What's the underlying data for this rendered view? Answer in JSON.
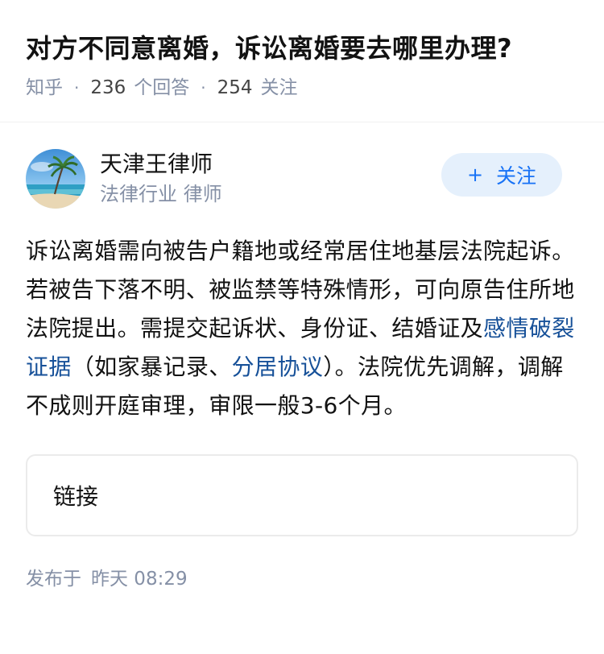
{
  "question": {
    "title": "对方不同意离婚，诉讼离婚要去哪里办理?",
    "source": "知乎",
    "answer_count": "236",
    "answer_label": "个回答",
    "follow_count": "254",
    "follow_label": "关注"
  },
  "author": {
    "name": "天津王律师",
    "headline": "法律行业 律师",
    "avatar_icon": "beach-palm-avatar",
    "follow_button": {
      "plus": "+",
      "label": "关注"
    }
  },
  "content": {
    "part1": "诉讼离婚需向被告户籍地或经常居住地基层法院起诉。若被告下落不明、被监禁等特殊情形，可向原告住所地法院提出。需提交起诉状、身份证、结婚证及",
    "link1": "感情破裂证据",
    "part2": "（如家暴记录、",
    "link2": "分居协议",
    "part3": "）。法院优先调解，调解不成则开庭审理，审限一般3-6个月。"
  },
  "link_card": {
    "label": "链接"
  },
  "publish": {
    "prefix": "发布于",
    "time": "昨天 08:29"
  },
  "colors": {
    "accent": "#1772f6",
    "link": "#175199",
    "meta": "#8590a6",
    "follow_bg": "#e5f0fc"
  }
}
